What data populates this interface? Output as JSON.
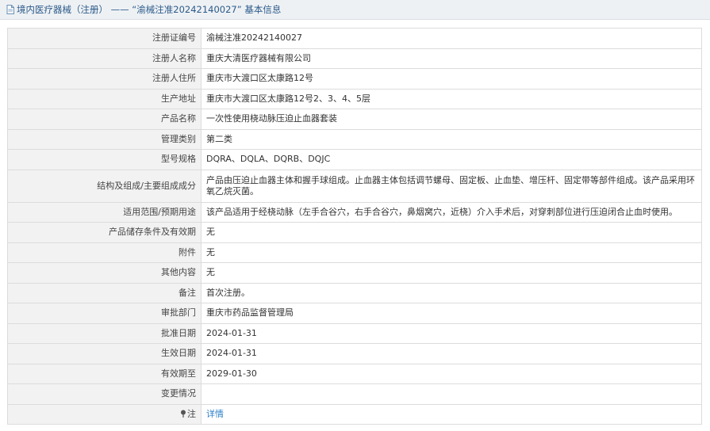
{
  "header": {
    "title": "境内医疗器械（注册） —— “渝械注准20242140027” 基本信息"
  },
  "rows": [
    {
      "label": "注册证编号",
      "value": "渝械注准20242140027"
    },
    {
      "label": "注册人名称",
      "value": "重庆大清医疗器械有限公司"
    },
    {
      "label": "注册人住所",
      "value": "重庆市大渡口区太康路12号"
    },
    {
      "label": "生产地址",
      "value": "重庆市大渡口区太康路12号2、3、4、5层"
    },
    {
      "label": "产品名称",
      "value": "一次性使用桡动脉压迫止血器套装"
    },
    {
      "label": "管理类别",
      "value": "第二类"
    },
    {
      "label": "型号规格",
      "value": "DQRA、DQLA、DQRB、DQJC"
    },
    {
      "label": "结构及组成/主要组成成分",
      "value": "产品由压迫止血器主体和握手球组成。止血器主体包括调节螺母、固定板、止血垫、增压杆、固定带等部件组成。该产品采用环氧乙烷灭菌。"
    },
    {
      "label": "适用范围/预期用途",
      "value": "该产品适用于经桡动脉（左手合谷穴，右手合谷穴，鼻烟窝穴，近桡）介入手术后，对穿刺部位进行压迫闭合止血时使用。"
    },
    {
      "label": "产品储存条件及有效期",
      "value": "无"
    },
    {
      "label": "附件",
      "value": "无"
    },
    {
      "label": "其他内容",
      "value": "无"
    },
    {
      "label": "备注",
      "value": "首次注册。"
    },
    {
      "label": "审批部门",
      "value": "重庆市药品监督管理局"
    },
    {
      "label": "批准日期",
      "value": "2024-01-31"
    },
    {
      "label": "生效日期",
      "value": "2024-01-31"
    },
    {
      "label": "有效期至",
      "value": "2029-01-30"
    },
    {
      "label": "变更情况",
      "value": ""
    }
  ],
  "note": {
    "label": "注",
    "link_text": "详情"
  }
}
